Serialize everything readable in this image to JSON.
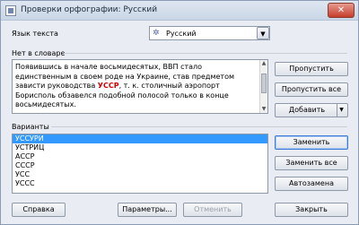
{
  "window": {
    "title": "Проверки орфографии: Русский",
    "close_glyph": "✕"
  },
  "language": {
    "label": "Язык текста",
    "value": "Русский",
    "flag_glyph": "✲",
    "dropdown_glyph": "▼"
  },
  "not_in_dictionary": {
    "label": "Нет в словаре",
    "text_before": "Появившись в начале восьмидесятых, ВВП стало единственным в своем роде на Украине, став предметом зависти руководства ",
    "misspelled": "УССР",
    "text_after": ", т. к. столичный аэропорт Борисполь обзавелся подобной полосой только в конце восьмидесятых."
  },
  "suggestions": {
    "label": "Варианты",
    "items": [
      "УССУРИ",
      "УСТРИЦ",
      "АССР",
      "СССР",
      "УСС",
      "УССС"
    ],
    "selected_index": 0
  },
  "buttons": {
    "skip": "Пропустить",
    "skip_all": "Пропустить все",
    "add": "Добавить",
    "replace": "Заменить",
    "replace_all": "Заменить все",
    "autocorrect": "Автозамена",
    "help": "Справка",
    "options": "Параметры...",
    "undo": "Отменить",
    "close": "Закрыть"
  },
  "scroll": {
    "up": "▲",
    "down": "▼"
  }
}
